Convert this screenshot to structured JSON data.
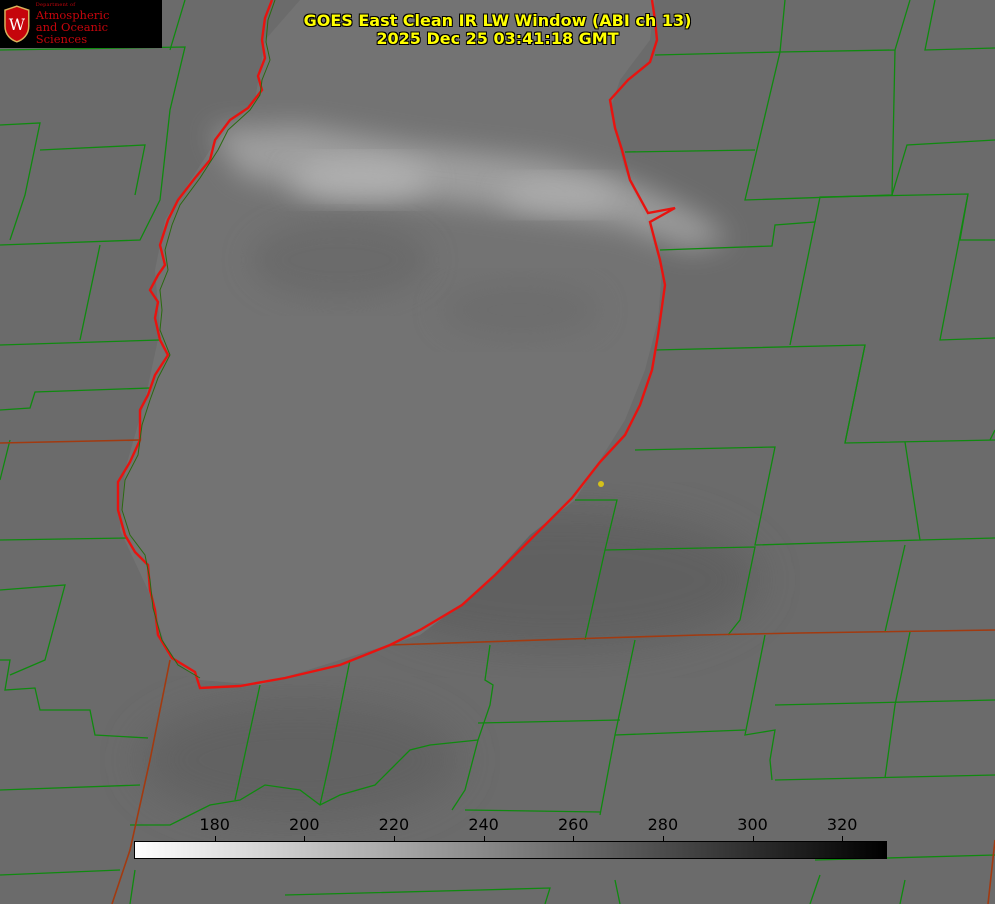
{
  "logo": {
    "small_text": "Department of",
    "line1": "Atmospheric",
    "line2": "and Oceanic Sciences",
    "crest_letter": "W",
    "colors": {
      "background": "#000000",
      "text": "#c5050c",
      "crest": "#c5050c"
    }
  },
  "title": {
    "line1": "GOES East Clean IR LW Window (ABI ch 13)",
    "line2": "2025 Dec 25 03:41:18 GMT"
  },
  "colorbar": {
    "ticks": [
      "180",
      "200",
      "220",
      "240",
      "260",
      "280",
      "300",
      "320"
    ],
    "range": [
      162,
      330
    ],
    "gradient": [
      "#ffffff",
      "#000000"
    ]
  },
  "map": {
    "layers": [
      "county-boundaries",
      "state-boundaries",
      "lake-michigan-shoreline"
    ],
    "colors": {
      "county": "#0f8a0f",
      "state": "#a23a10",
      "coastline": "#e8130f",
      "marker": "#d4c11a",
      "cloud": "#b0b0b0",
      "land": "#6b6b6b"
    }
  }
}
